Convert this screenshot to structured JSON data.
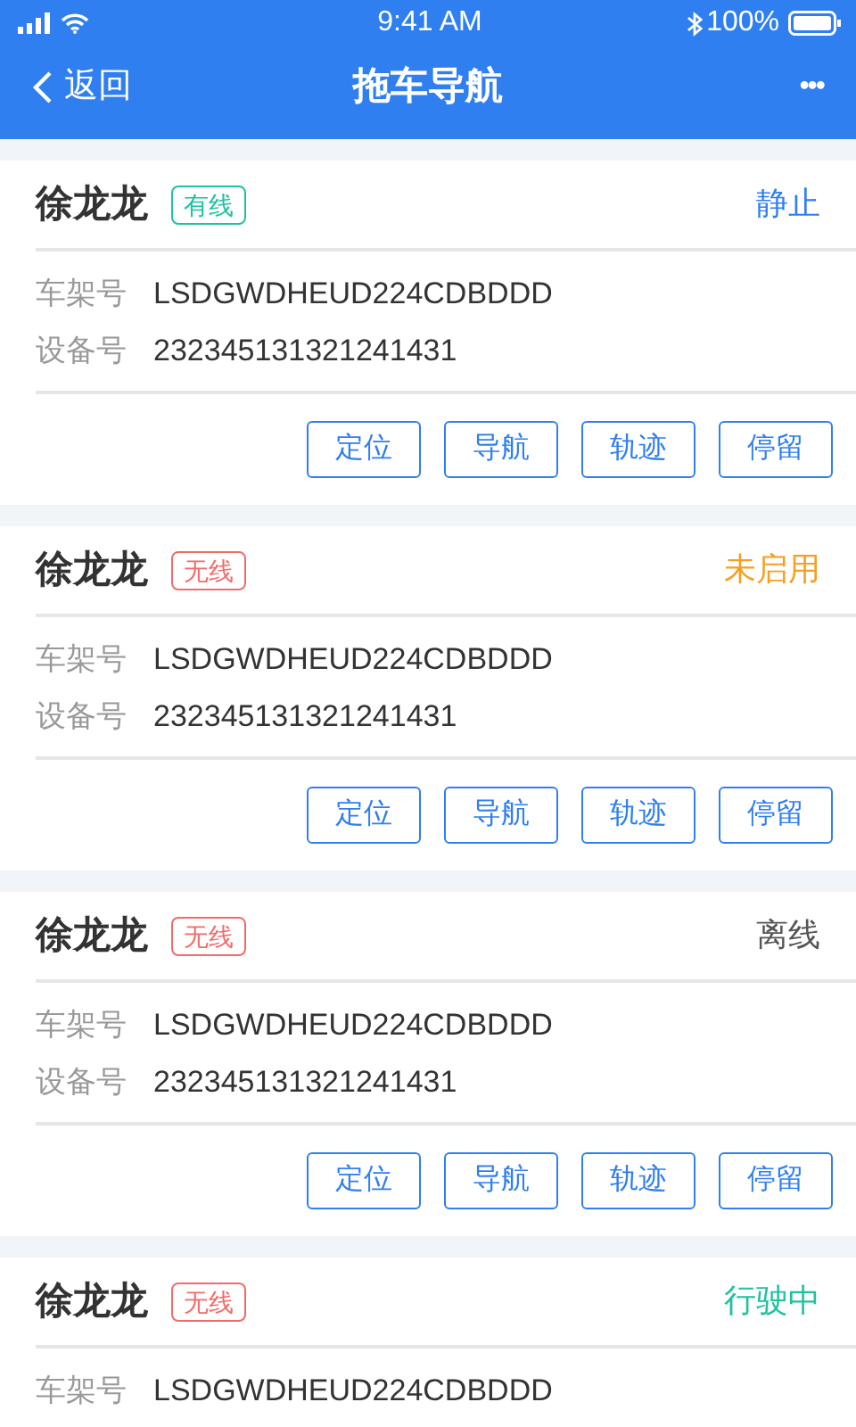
{
  "status_bar": {
    "time": "9:41 AM",
    "battery": "100%"
  },
  "nav": {
    "back": "返回",
    "title": "拖车导航",
    "more": "•••"
  },
  "cards": [
    {
      "name": "徐龙龙",
      "tag": {
        "label": "有线",
        "color": "#1fc2a0"
      },
      "status": {
        "label": "静止",
        "color": "#2f7ff0"
      },
      "frame_label": "车架号",
      "frame_number": "LSDGWDHEUD224CDBDDD",
      "device_label": "设备号",
      "device_number": "232345131321241431",
      "actions": [
        "定位",
        "导航",
        "轨迹",
        "停留"
      ]
    },
    {
      "name": "徐龙龙",
      "tag": {
        "label": "无线",
        "color": "#f26b6b"
      },
      "status": {
        "label": "未启用",
        "color": "#f5a023"
      },
      "frame_label": "车架号",
      "frame_number": "LSDGWDHEUD224CDBDDD",
      "device_label": "设备号",
      "device_number": "232345131321241431",
      "actions": [
        "定位",
        "导航",
        "轨迹",
        "停留"
      ]
    },
    {
      "name": "徐龙龙",
      "tag": {
        "label": "无线",
        "color": "#f26b6b"
      },
      "status": {
        "label": "离线",
        "color": "#555555"
      },
      "frame_label": "车架号",
      "frame_number": "LSDGWDHEUD224CDBDDD",
      "device_label": "设备号",
      "device_number": "232345131321241431",
      "actions": [
        "定位",
        "导航",
        "轨迹",
        "停留"
      ]
    },
    {
      "name": "徐龙龙",
      "tag": {
        "label": "无线",
        "color": "#f26b6b"
      },
      "status": {
        "label": "行驶中",
        "color": "#1fc2a0"
      },
      "frame_label": "车架号",
      "frame_number": "LSDGWDHEUD224CDBDDD"
    }
  ]
}
